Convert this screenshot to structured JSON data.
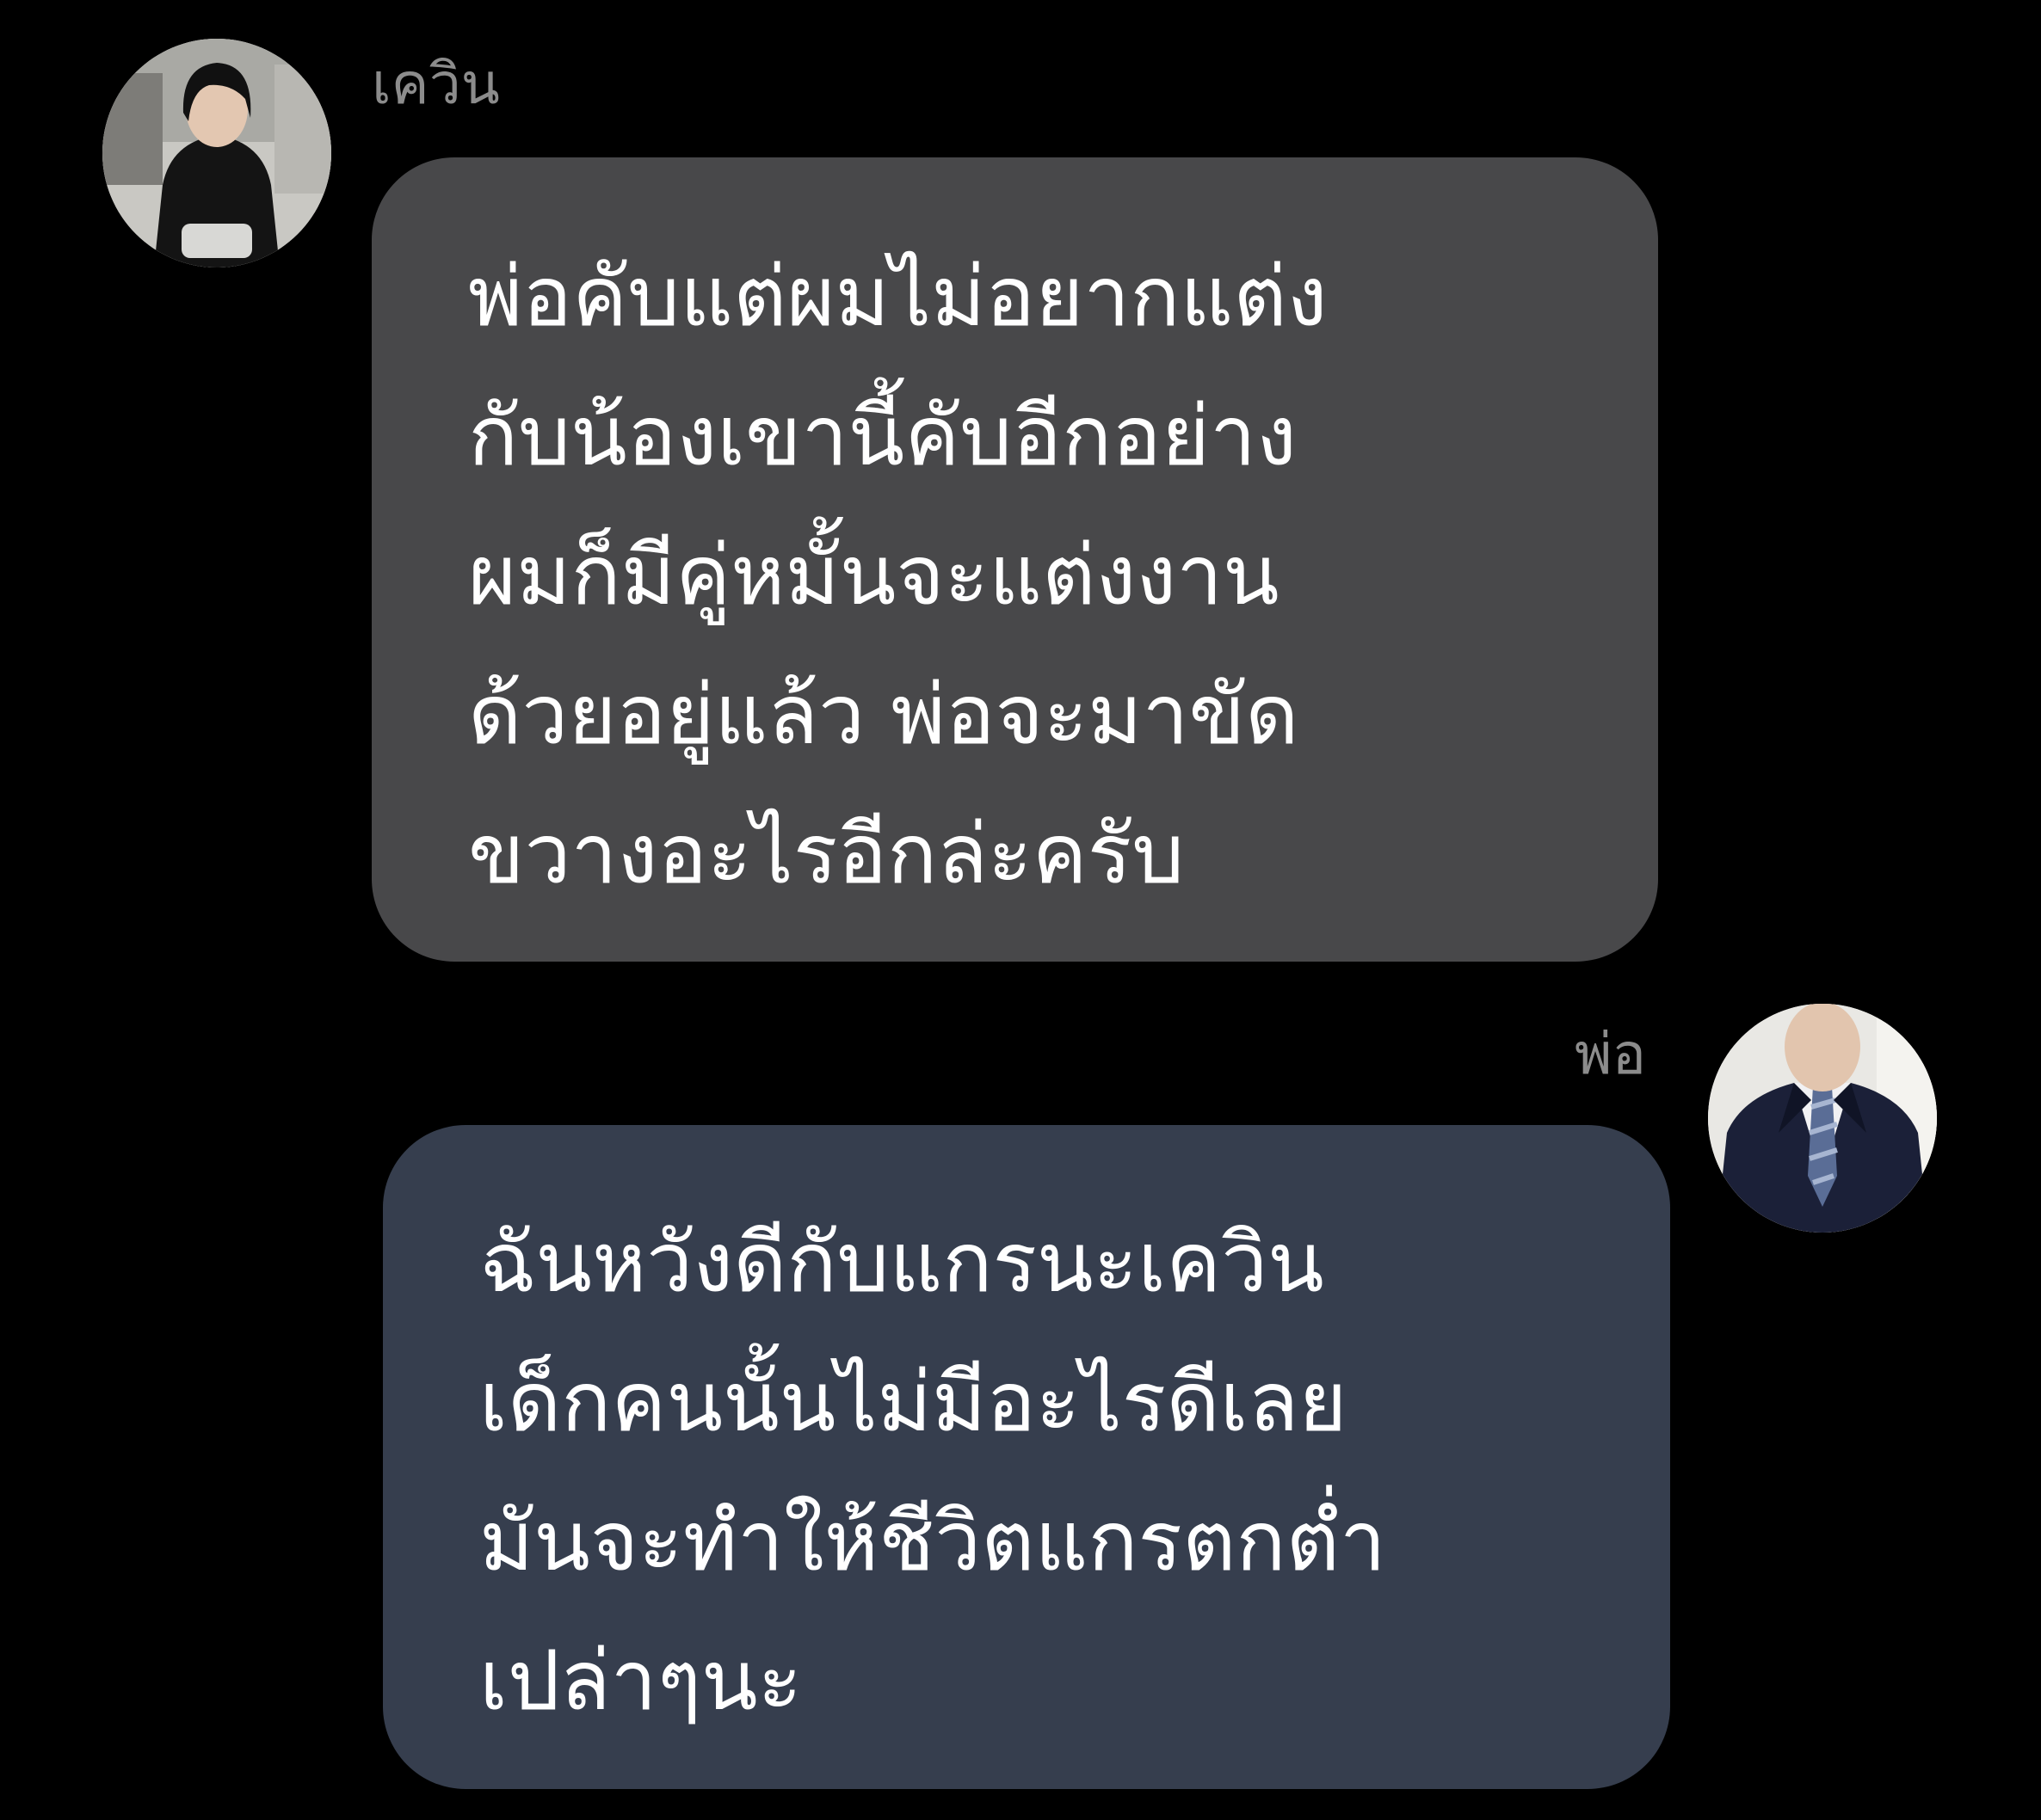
{
  "colors": {
    "background": "#000000",
    "name_text": "#8c8c8c",
    "message_text": "#ffffff",
    "incoming_bubble": "#48484a",
    "outgoing_bubble": "#363e4e"
  },
  "messages": [
    {
      "sender": "เควิน",
      "avatar": "young-man-photo",
      "side": "left",
      "lines": [
        "พ่อคับแต่ผมไม่อยากแต่ง",
        "กับน้องเขานี้คับอีกอย่าง",
        "ผมก็มีคู่หมั้นจะแต่งงาน",
        "ด้วยอยู่แล้ว พ่อจะมาขัด",
        "ขวางอะไรอีกล่ะครับ"
      ]
    },
    {
      "sender": "พ่อ",
      "avatar": "man-in-suit-photo",
      "side": "right",
      "lines": [
        "ฉันหวังดีกับแกรนะเควิน",
        "เด็กคนนั้นไม่มีอะไรดีเลย",
        "มันจะทำให้ชีวิตแกรตกต่ำ",
        "เปล่าๆนะ"
      ]
    }
  ]
}
